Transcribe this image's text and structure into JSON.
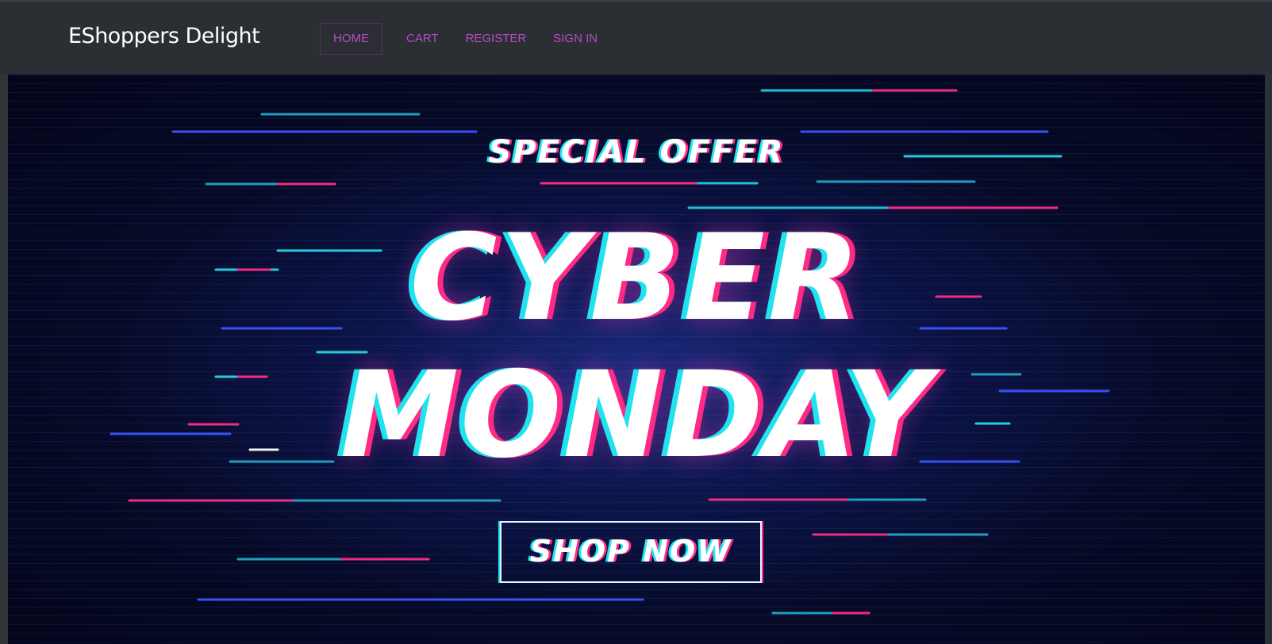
{
  "header": {
    "brand": "EShoppers Delight",
    "nav": [
      {
        "label": "HOME",
        "active": true
      },
      {
        "label": "CART",
        "active": false
      },
      {
        "label": "REGISTER",
        "active": false
      },
      {
        "label": "SIGN IN",
        "active": false
      }
    ]
  },
  "hero": {
    "eyebrow": "SPECIAL OFFER",
    "headline_line1": "CYBER",
    "headline_line2": "MONDAY",
    "cta_label": "SHOP NOW"
  },
  "colors": {
    "nav_background": "#2b2f33",
    "nav_link": "#b54bc4",
    "hero_background": "#060a26",
    "glitch_cyan": "#22e6f0",
    "glitch_pink": "#ff2d8a"
  }
}
